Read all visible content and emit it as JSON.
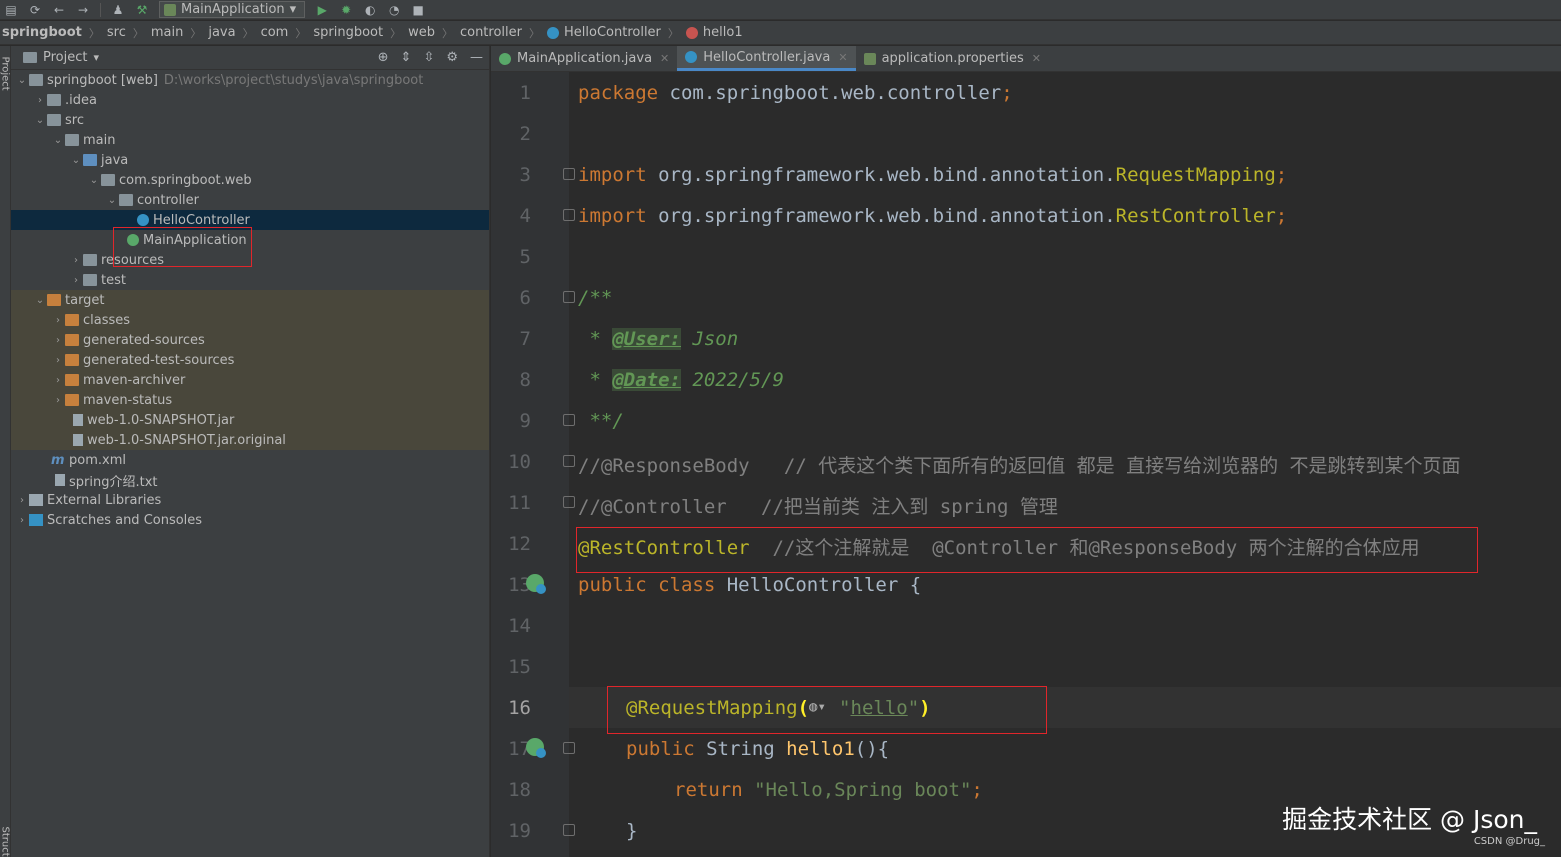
{
  "toolbar": {
    "run_config": "MainApplication"
  },
  "breadcrumb": [
    "springboot",
    "src",
    "main",
    "java",
    "com",
    "springboot",
    "web",
    "controller",
    "HelloController",
    "hello1"
  ],
  "left_strip": {
    "project_label": "Project",
    "structure_label": "Structure"
  },
  "project_panel": {
    "title": "Project",
    "tree": [
      {
        "label": "springboot [web]",
        "extra": "D:\\works\\project\\studys\\java\\springboot"
      },
      {
        "label": ".idea"
      },
      {
        "label": "src"
      },
      {
        "label": "main"
      },
      {
        "label": "java"
      },
      {
        "label": "com.springboot.web"
      },
      {
        "label": "controller"
      },
      {
        "label": "HelloController"
      },
      {
        "label": "MainApplication"
      },
      {
        "label": "resources"
      },
      {
        "label": "test"
      },
      {
        "label": "target"
      },
      {
        "label": "classes"
      },
      {
        "label": "generated-sources"
      },
      {
        "label": "generated-test-sources"
      },
      {
        "label": "maven-archiver"
      },
      {
        "label": "maven-status"
      },
      {
        "label": "web-1.0-SNAPSHOT.jar"
      },
      {
        "label": "web-1.0-SNAPSHOT.jar.original"
      },
      {
        "label": "pom.xml"
      },
      {
        "label": "spring介绍.txt"
      },
      {
        "label": "External Libraries"
      },
      {
        "label": "Scratches and Consoles"
      }
    ]
  },
  "editor_tabs": [
    {
      "label": "MainApplication.java"
    },
    {
      "label": "HelloController.java"
    },
    {
      "label": "application.properties"
    }
  ],
  "code": {
    "line_numbers": [
      "1",
      "2",
      "3",
      "4",
      "5",
      "6",
      "7",
      "8",
      "9",
      "10",
      "11",
      "12",
      "13",
      "14",
      "15",
      "16",
      "17",
      "18",
      "19"
    ],
    "l1_kw": "package",
    "l1_rest": " com.springboot.web.controller",
    "semicolon": ";",
    "import_kw": "import",
    "l3_pkg": " org.springframework.web.bind.annotation.",
    "l3_cls": "RequestMapping",
    "l4_pkg": " org.springframework.web.bind.annotation.",
    "l4_cls": "RestController",
    "l6": "/**",
    "l7_star": " * ",
    "l7_tag": "@User:",
    "l7_val": " Json",
    "l8_star": " * ",
    "l8_tag": "@Date:",
    "l8_val": " 2022/5/9",
    "l9": " **/",
    "l10_code": "//@ResponseBody",
    "l10_cmt": "   // 代表这个类下面所有的返回值 都是 直接写给浏览器的 不是跳转到某个页面",
    "l11_code": "//@Controller",
    "l11_cmt": "   //把当前类 注入到 spring 管理",
    "l12_ann": "@RestController",
    "l12_cmt": "  //这个注解就是  @Controller 和@ResponseBody 两个注解的合体应用",
    "l13_kw": "public class",
    "l13_rest": " HelloController {",
    "l16_ann": "@RequestMapping",
    "l16_open": "(",
    "l16_q": "\"",
    "l16_str": "hello",
    "l16_close": ")",
    "l17_kw": "public",
    "l17_type": " String ",
    "l17_fn": "hello1",
    "l17_rest": "(){",
    "l18_kw": "return",
    "l18_str": " \"Hello,Spring boot\"",
    "l19": "}"
  },
  "watermark": {
    "main": "掘金技术社区 @ Json_",
    "small": "CSDN @Drug_"
  }
}
